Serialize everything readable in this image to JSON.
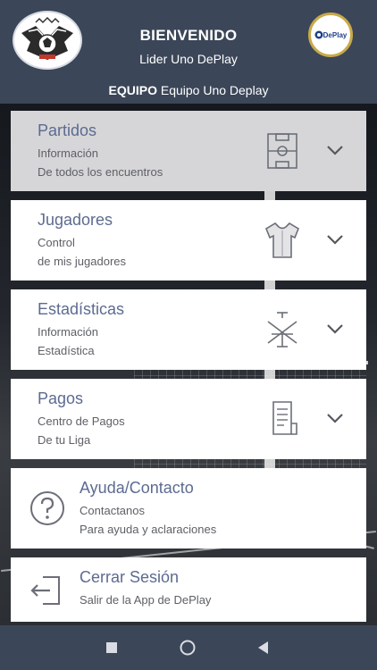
{
  "header": {
    "welcome": "BIENVENIDO",
    "leader": "Lider Uno DePlay",
    "team_label": "EQUIPO",
    "team_name": "Equipo Uno Deplay",
    "brand_logo_text": "DePlay"
  },
  "menu": [
    {
      "title": "Partidos",
      "line1": "Información",
      "line2": "De todos los encuentros",
      "icon": "field-icon",
      "active": true
    },
    {
      "title": "Jugadores",
      "line1": "Control",
      "line2": "de mis jugadores",
      "icon": "jersey-icon"
    },
    {
      "title": "Estadísticas",
      "line1": "Información",
      "line2": "Estadística",
      "icon": "tactics-icon"
    },
    {
      "title": "Pagos",
      "line1": "Centro de Pagos",
      "line2": "De tu Liga",
      "icon": "receipt-icon"
    },
    {
      "title": "Ayuda/Contacto",
      "line1": "Contactanos",
      "line2": "Para ayuda y aclaraciones",
      "icon": "question-icon"
    },
    {
      "title": "Cerrar Sesión",
      "line1": "Salir de la App de DePlay",
      "icon": "logout-icon"
    }
  ],
  "colors": {
    "header_bg": "#3b4658",
    "title_color": "#5d6b91",
    "active_card": "#d6d6d8"
  },
  "system_nav": [
    "recents-button",
    "home-button",
    "back-button"
  ]
}
